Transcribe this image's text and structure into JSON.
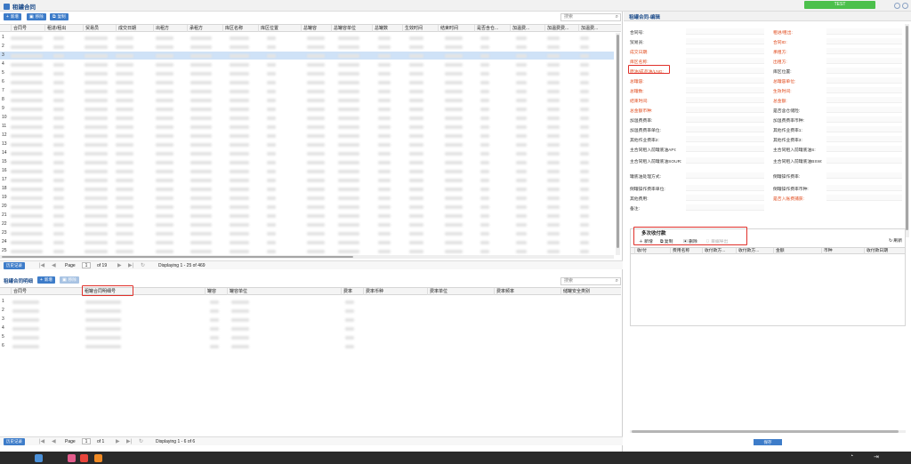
{
  "app": {
    "title": "租罐合同",
    "test_label": "TEST"
  },
  "main_toolbar": {
    "add_label": "新增",
    "delete_label": "移除",
    "copy_label": "复制",
    "search_placeholder": "搜索"
  },
  "main_grid": {
    "columns": [
      "合同号",
      "租进/租出",
      "贸易员",
      "成交日期",
      "出租方",
      "承租方",
      "库区名称",
      "库区位置",
      "总罐容",
      "总罐容单位",
      "总罐数",
      "生效时间",
      "结束时间",
      "是否含仓...",
      "加温费...",
      "加温费费...",
      "加温费..."
    ],
    "row_numbers": [
      "1",
      "2",
      "3",
      "4",
      "5",
      "6",
      "7",
      "8",
      "9",
      "10",
      "11",
      "12",
      "13",
      "14",
      "15",
      "16",
      "17",
      "18",
      "19",
      "20",
      "21",
      "22",
      "23",
      "24",
      "25"
    ]
  },
  "main_pager": {
    "history_label": "历史记录",
    "page_label": "Page",
    "page_value": "1",
    "of_label": "of 19",
    "display_text": "Displaying 1 - 25 of 469"
  },
  "detail": {
    "title": "租罐合同明细",
    "add_label": "新增",
    "delete_label": "移除",
    "search_placeholder": "搜索",
    "columns": [
      "合同号",
      "租罐合同明细号",
      "罐容",
      "罐容单位",
      "费率",
      "费率币种",
      "费率单位",
      "费率频率",
      "储罐安全类别"
    ],
    "row_numbers": [
      "1",
      "2",
      "3",
      "4",
      "5",
      "6"
    ]
  },
  "detail_pager": {
    "history_label": "历史记录",
    "page_label": "Page",
    "page_value": "1",
    "of_label": "of 1",
    "display_text": "Displaying 1 - 6 of 6"
  },
  "edit_panel": {
    "title": "租罐合同-编辑",
    "left_labels": [
      {
        "text": "合同号:",
        "req": false
      },
      {
        "text": "贸易员:",
        "req": false
      },
      {
        "text": "成交日期:",
        "req": true
      },
      {
        "text": "库区名称:",
        "req": true
      },
      {
        "text": "原油/成品油/LNG:",
        "req": true
      },
      {
        "text": "总罐容:",
        "req": true
      },
      {
        "text": "总罐数:",
        "req": true
      },
      {
        "text": "结束时间:",
        "req": true
      },
      {
        "text": "总金额币种:",
        "req": true
      },
      {
        "text": "加温费费率:",
        "req": false
      },
      {
        "text": "加温费费率单位:",
        "req": false
      },
      {
        "text": "其他作业费率2:",
        "req": false
      },
      {
        "text": "主合同租入前罐底油API:",
        "req": false
      },
      {
        "text": "主合同租入前罐底油SOUR:",
        "req": false
      },
      {
        "text": "罐底油处理方式:",
        "req": false
      },
      {
        "text": "倒罐操作费率单位:",
        "req": false
      },
      {
        "text": "其他费用:",
        "req": false
      },
      {
        "text": "备注:",
        "req": false
      }
    ],
    "right_labels": [
      {
        "text": "租进/租出:",
        "req": true
      },
      {
        "text": "合同ID:",
        "req": true
      },
      {
        "text": "承租方:",
        "req": true
      },
      {
        "text": "出租方:",
        "req": true
      },
      {
        "text": "库区位置:",
        "req": false
      },
      {
        "text": "总罐容单位:",
        "req": true
      },
      {
        "text": "生效时间:",
        "req": true
      },
      {
        "text": "总金额:",
        "req": true
      },
      {
        "text": "是否含仓储险:",
        "req": false
      },
      {
        "text": "加温费费率币种:",
        "req": false
      },
      {
        "text": "其他作业费率1:",
        "req": false
      },
      {
        "text": "其他作业费率3:",
        "req": false
      },
      {
        "text": "主合同租入前罐底油S:",
        "req": false
      },
      {
        "text": "主合同租入前罐底油BSW:",
        "req": false
      },
      {
        "text": "倒罐操作费率:",
        "req": false
      },
      {
        "text": "倒罐操作费率币种:",
        "req": false
      },
      {
        "text": "是否入账费捕获:",
        "req": true
      }
    ]
  },
  "payment": {
    "title": "多次收付款",
    "add_label": "新增",
    "copy_label": "复制",
    "delete_label": "删除",
    "bill_label": "单据导出",
    "refresh_label": "刷新",
    "columns": [
      "收/付",
      "费用名称",
      "收付款方...",
      "收付款方...",
      "金额",
      "币种",
      "收付款日期"
    ]
  },
  "save_label": "保存"
}
